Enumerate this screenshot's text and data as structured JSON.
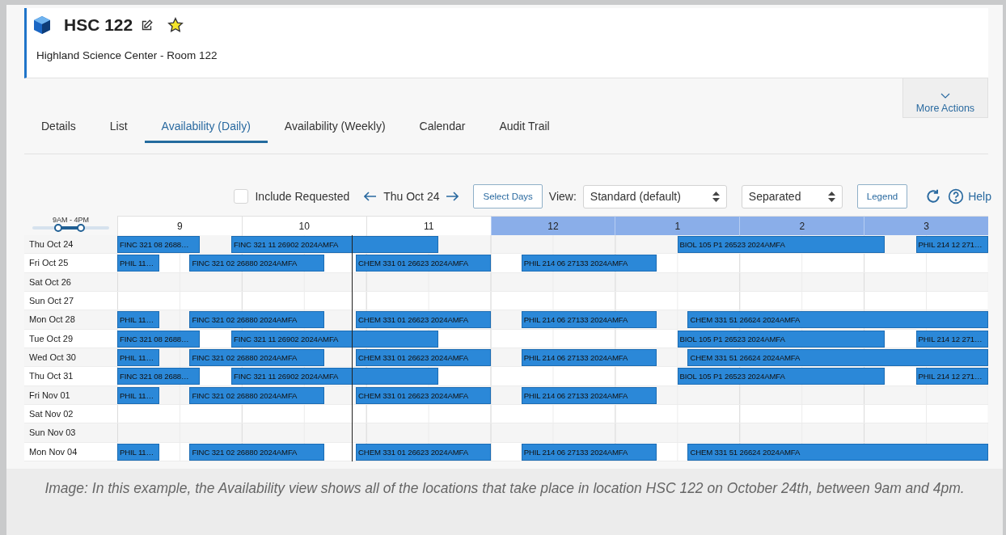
{
  "header": {
    "title": "HSC 122",
    "favorite": true,
    "subtitle": "Highland Science Center - Room 122"
  },
  "more_actions": {
    "label": "More Actions"
  },
  "tabs": [
    {
      "label": "Details",
      "selected": false
    },
    {
      "label": "List",
      "selected": false
    },
    {
      "label": "Availability (Daily)",
      "selected": true
    },
    {
      "label": "Availability (Weekly)",
      "selected": false
    },
    {
      "label": "Calendar",
      "selected": false
    },
    {
      "label": "Audit Trail",
      "selected": false
    }
  ],
  "toolbar": {
    "include_requested": {
      "label": "Include Requested",
      "checked": false
    },
    "date": "Thu Oct 24",
    "select_days": "Select Days",
    "view_label": "View:",
    "view_select": "Standard (default)",
    "mode_select": "Separated",
    "legend": "Legend",
    "help": "Help"
  },
  "range_slider": {
    "label": "9AM - 4PM",
    "thumbs": [
      {
        "level": 0.34
      },
      {
        "level": 0.63
      }
    ]
  },
  "hours": [
    {
      "label": "9",
      "highlighted": false
    },
    {
      "label": "10",
      "highlighted": false
    },
    {
      "label": "11",
      "highlighted": false
    },
    {
      "label": "12",
      "highlighted": true
    },
    {
      "label": "1",
      "highlighted": true
    },
    {
      "label": "2",
      "highlighted": true
    },
    {
      "label": "3",
      "highlighted": true
    }
  ],
  "days": [
    {
      "label": "Thu Oct 24",
      "events": [
        "FINC 321 08 2688…",
        "FINC 321 11 26902 2024AMFA",
        "BIOL 105 P1 26523 2024AMFA",
        "PHIL 214 12 271…"
      ]
    },
    {
      "label": "Fri Oct 25",
      "events": [
        "PHIL 11…",
        "FINC 321 02 26880 2024AMFA",
        "CHEM 331 01 26623 2024AMFA",
        "PHIL 214 06 27133 2024AMFA"
      ]
    },
    {
      "label": "Sat Oct 26"
    },
    {
      "label": "Sun Oct 27"
    },
    {
      "label": "Mon Oct 28",
      "events": [
        "PHIL 11…",
        "FINC 321 02 26880 2024AMFA",
        "CHEM 331 01 26623 2024AMFA",
        "PHIL 214 06 27133 2024AMFA",
        "CHEM 331 51 26624 2024AMFA"
      ]
    },
    {
      "label": "Tue Oct 29",
      "events": [
        "FINC 321 08 2688…",
        "FINC 321 11 26902 2024AMFA",
        "BIOL 105 P1 26523 2024AMFA",
        "PHIL 214 12 271…"
      ]
    },
    {
      "label": "Wed Oct 30",
      "events": [
        "PHIL 11…",
        "FINC 321 02 26880 2024AMFA",
        "CHEM 331 01 26623 2024AMFA",
        "PHIL 214 06 27133 2024AMFA",
        "CHEM 331 51 26624 2024AMFA"
      ]
    },
    {
      "label": "Thu Oct 31",
      "events": [
        "FINC 321 08 2688…",
        "FINC 321 11 26902 2024AMFA",
        "BIOL 105 P1 26523 2024AMFA",
        "PHIL 214 12 271…"
      ]
    },
    {
      "label": "Fri Nov 01",
      "events": [
        "PHIL 11…",
        "FINC 321 02 26880 2024AMFA",
        "CHEM 331 01 26623 2024AMFA",
        "PHIL 214 06 27133 2024AMFA"
      ]
    },
    {
      "label": "Sat Nov 02"
    },
    {
      "label": "Sun Nov 03"
    },
    {
      "label": "Mon Nov 04",
      "events": [
        "PHIL 11…",
        "FINC 321 02 26880 2024AMFA",
        "CHEM 331 01 26623 2024AMFA",
        "PHIL 214 06 27133 2024AMFA",
        "CHEM 331 51 26624 2024AMFA"
      ]
    }
  ],
  "caption": "Image: In this example, the Availability view shows all of the locations that take place in location HSC 122 on October 24th, between 9am and 4pm."
}
